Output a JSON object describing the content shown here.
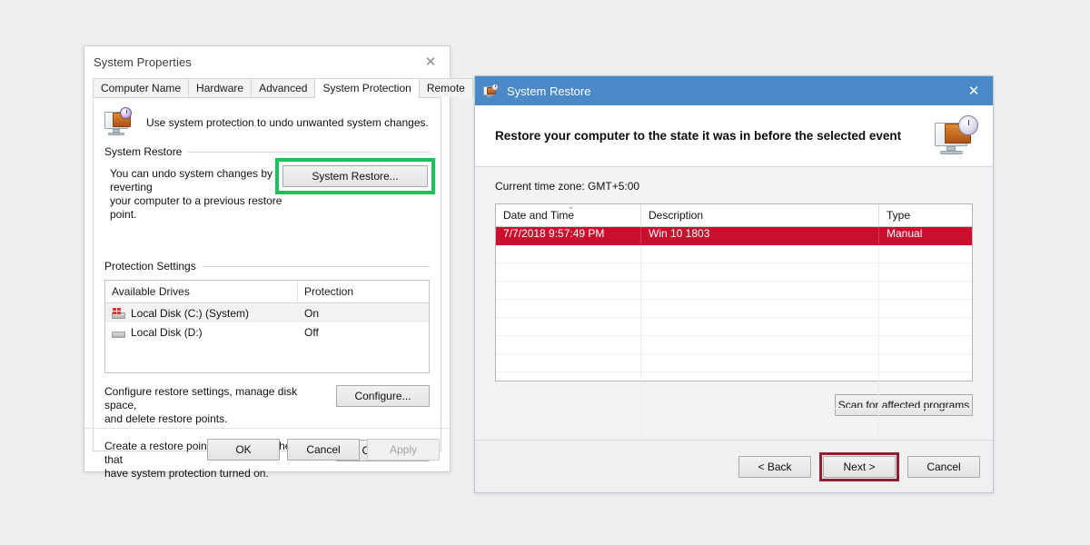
{
  "system_properties": {
    "title": "System Properties",
    "close_icon": "close-icon",
    "tabs": [
      {
        "label": "Computer Name",
        "active": false
      },
      {
        "label": "Hardware",
        "active": false
      },
      {
        "label": "Advanced",
        "active": false
      },
      {
        "label": "System Protection",
        "active": true
      },
      {
        "label": "Remote",
        "active": false
      }
    ],
    "intro_text": "Use system protection to undo unwanted system changes.",
    "intro_icon": "system-protection-icon",
    "system_restore": {
      "legend": "System Restore",
      "description_line1": "You can undo system changes by reverting",
      "description_line2": "your computer to a previous restore point.",
      "button_label": "System Restore...",
      "highlight_color": "#18c45a"
    },
    "protection_settings": {
      "legend": "Protection Settings",
      "columns": [
        "Available Drives",
        "Protection"
      ],
      "rows": [
        {
          "drive": "Local Disk (C:) (System)",
          "protection": "On",
          "icon": "system-drive-icon",
          "selected": true
        },
        {
          "drive": "Local Disk (D:)",
          "protection": "Off",
          "icon": "drive-icon",
          "selected": false
        }
      ],
      "configure_text_line1": "Configure restore settings, manage disk space,",
      "configure_text_line2": "and delete restore points.",
      "configure_button": "Configure...",
      "create_text_line1": "Create a restore point right now for the drives that",
      "create_text_line2": "have system protection turned on.",
      "create_button": "Create..."
    },
    "footer": {
      "ok": "OK",
      "cancel": "Cancel",
      "apply": "Apply",
      "apply_disabled": true
    }
  },
  "system_restore_wizard": {
    "title": "System Restore",
    "title_icon": "system-restore-icon",
    "close_icon": "close-icon",
    "titlebar_color": "#4a89c8",
    "heading": "Restore your computer to the state it was in before the selected event",
    "header_icon": "restore-monitor-clock-icon",
    "time_zone_label": "Current time zone: GMT+5:00",
    "grid": {
      "columns": [
        "Date and Time",
        "Description",
        "Type"
      ],
      "sort_icon": "chevron-down-icon",
      "rows": [
        {
          "date_time": "7/7/2018 9:57:49 PM",
          "description": "Win 10 1803",
          "type": "Manual",
          "selected": true
        }
      ],
      "empty_row_count": 12,
      "selected_row_color": "#c8102e"
    },
    "scan_button": "Scan for affected programs",
    "footer": {
      "back": "< Back",
      "next": "Next >",
      "cancel": "Cancel",
      "next_highlight_color": "#8c2230"
    }
  }
}
